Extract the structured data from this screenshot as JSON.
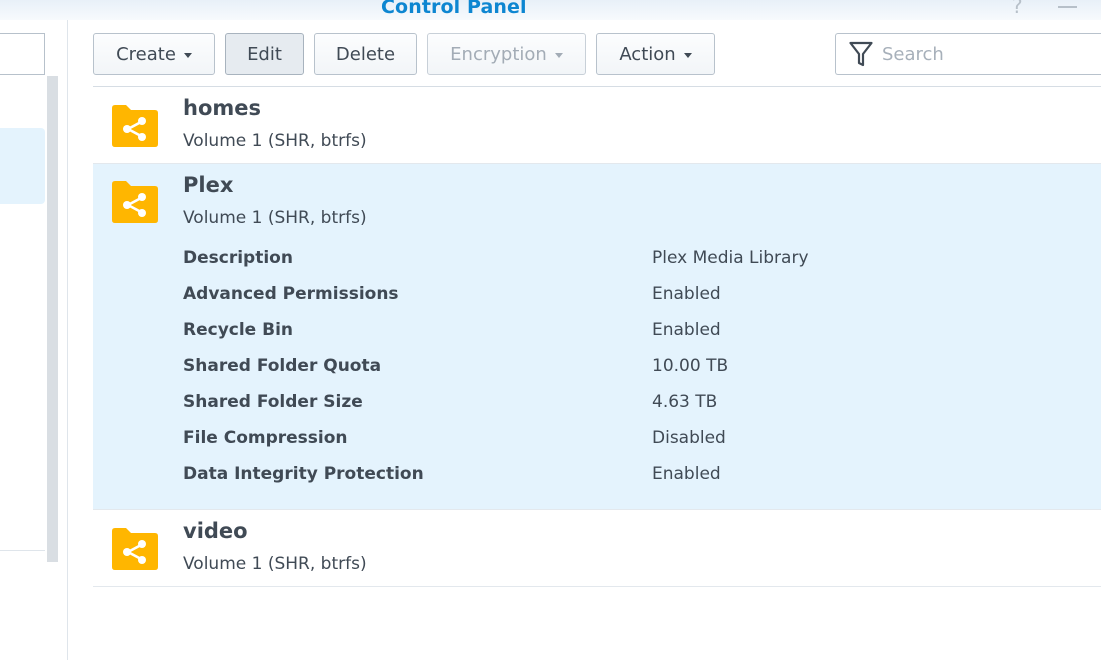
{
  "window": {
    "title": "Control Panel",
    "help_glyph": "?"
  },
  "toolbar": {
    "create": "Create",
    "edit": "Edit",
    "delete": "Delete",
    "encryption": "Encryption",
    "action": "Action",
    "search_placeholder": "Search"
  },
  "folders": [
    {
      "name": "homes",
      "volume": "Volume 1 (SHR, btrfs)"
    },
    {
      "name": "Plex",
      "volume": "Volume 1 (SHR, btrfs)",
      "details": [
        {
          "label": "Description",
          "value": "Plex Media Library"
        },
        {
          "label": "Advanced Permissions",
          "value": "Enabled"
        },
        {
          "label": "Recycle Bin",
          "value": "Enabled"
        },
        {
          "label": "Shared Folder Quota",
          "value": "10.00 TB"
        },
        {
          "label": "Shared Folder Size",
          "value": "4.63 TB"
        },
        {
          "label": "File Compression",
          "value": "Disabled"
        },
        {
          "label": "Data Integrity Protection",
          "value": "Enabled"
        }
      ]
    },
    {
      "name": "video",
      "volume": "Volume 1 (SHR, btrfs)"
    }
  ],
  "colors": {
    "accent": "#0d86d1",
    "folder": "#ffb600",
    "selected_row": "#e4f3fd"
  }
}
